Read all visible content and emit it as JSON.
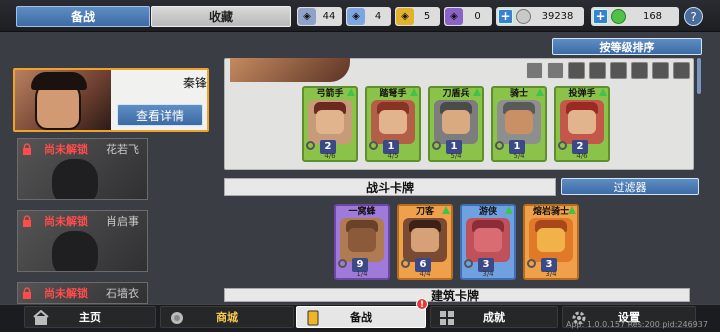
{
  "tabs": {
    "prepare": "备战",
    "collection": "收藏"
  },
  "resources": {
    "items": [
      {
        "value": "44",
        "color": "#8ea3c7"
      },
      {
        "value": "4",
        "color": "#7da6e0"
      },
      {
        "value": "5",
        "color": "#e0b22e"
      },
      {
        "value": "0",
        "color": "#8a62c8"
      }
    ],
    "coins": "39238",
    "gems": "168",
    "help": "?"
  },
  "hero": {
    "name": "秦锋",
    "details_button": "查看详情"
  },
  "locked_heroes": [
    {
      "label": "尚未解锁",
      "name": "花若飞"
    },
    {
      "label": "尚未解锁",
      "name": "肖启事"
    },
    {
      "label": "尚未解锁",
      "name": "石墙衣"
    }
  ],
  "toolbar": {
    "sort_button": "按等级排序",
    "filter_button": "过滤器"
  },
  "sections": {
    "battle_cards": "战斗卡牌",
    "building_cards": "建筑卡牌"
  },
  "top_row_cards": [
    {
      "name": "弓箭手",
      "level": "2",
      "progress": "4/6",
      "rarity": "green"
    },
    {
      "name": "踏弩手",
      "level": "1",
      "progress": "4/5",
      "rarity": "green"
    },
    {
      "name": "刀盾兵",
      "level": "1",
      "progress": "5/4",
      "rarity": "green"
    },
    {
      "name": "骑士",
      "level": "1",
      "progress": "5/4",
      "rarity": "green"
    },
    {
      "name": "投弹手",
      "level": "2",
      "progress": "4/6",
      "rarity": "green"
    }
  ],
  "battle_cards": [
    {
      "name": "一窝蜂",
      "level": "9",
      "progress": "1/4",
      "rarity": "purple"
    },
    {
      "name": "刀客",
      "level": "6",
      "progress": "4/4",
      "rarity": "orange"
    },
    {
      "name": "游侠",
      "level": "3",
      "progress": "3/4",
      "rarity": "blue"
    },
    {
      "name": "熔岩骑士",
      "level": "3",
      "progress": "3/4",
      "rarity": "orange"
    }
  ],
  "nav": {
    "home": "主页",
    "shop": "商城",
    "prepare": "备战",
    "achievements": "成就",
    "settings": "设置",
    "badge": "!"
  },
  "version_text": "App: 1.0.0.157 Res:200 pid:246937"
}
